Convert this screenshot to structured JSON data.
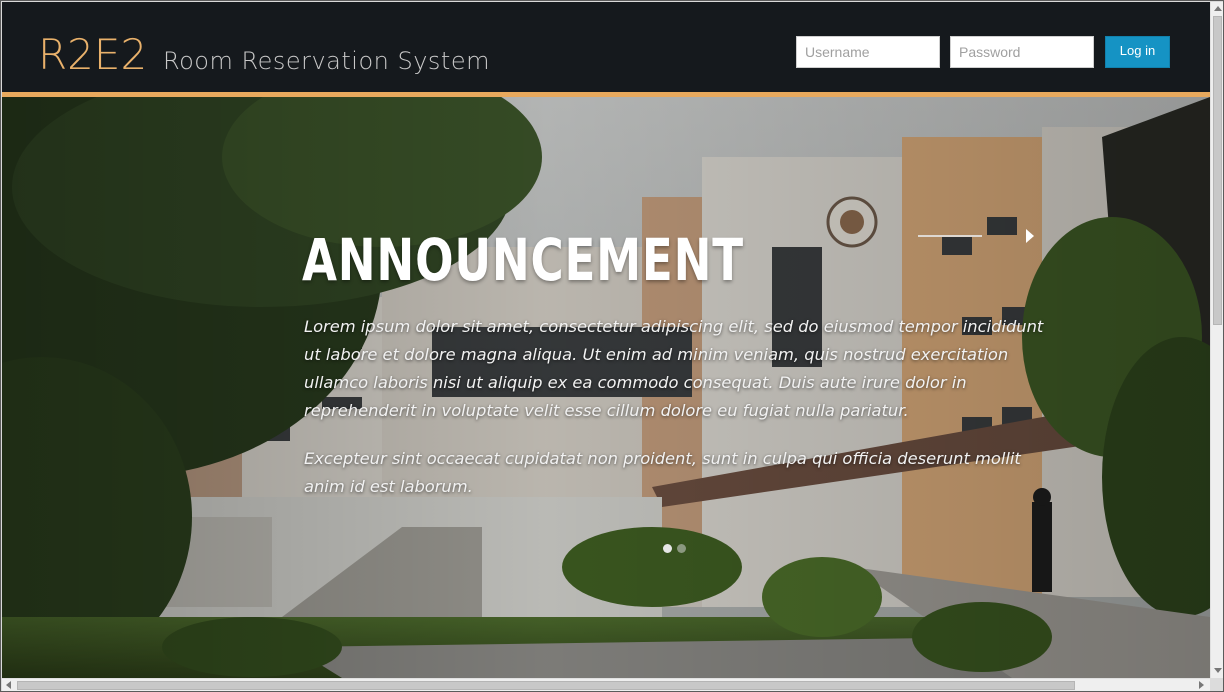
{
  "header": {
    "logo": "R2E2",
    "subtitle": "Room Reservation System",
    "username_placeholder": "Username",
    "password_placeholder": "Password",
    "login_label": "Log in"
  },
  "hero": {
    "headline": "ANNOUNCEMENT",
    "paragraph1": "Lorem ipsum dolor sit amet, consectetur adipiscing elit, sed do eiusmod tempor incididunt ut labore et dolore magna aliqua. Ut enim ad minim veniam, quis nostrud exercitation ullamco laboris nisi ut aliquip ex ea commodo consequat. Duis aute irure dolor in reprehenderit in voluptate velit esse cillum dolore eu fugiat nulla pariatur.",
    "paragraph2": "Excepteur sint occaecat cupidatat non proident, sunt in culpa qui officia deserunt mollit anim id est laborum.",
    "next_icon": "chevron-right-icon",
    "slide_count": 2,
    "active_slide": 1
  },
  "colors": {
    "header_bg": "#15191d",
    "accent": "#e8a95d",
    "button": "#1593c4"
  }
}
